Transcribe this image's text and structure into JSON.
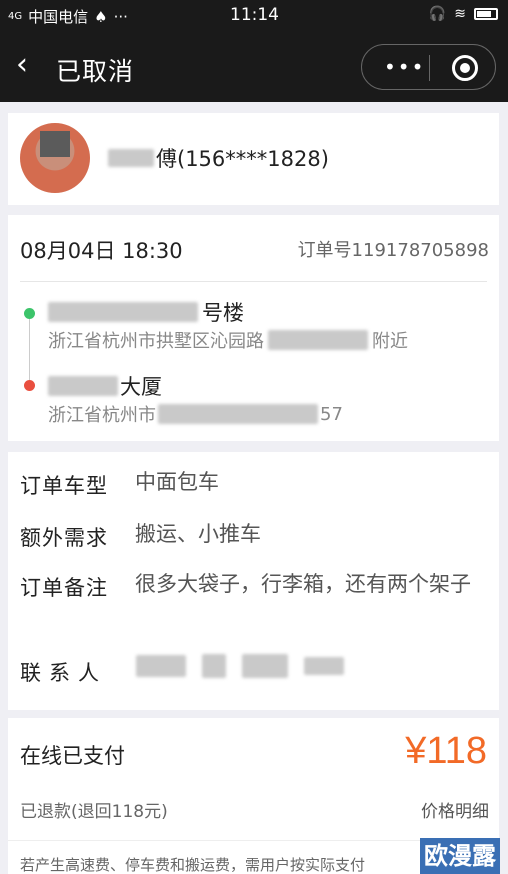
{
  "statusbar": {
    "signal": "4G",
    "carrier": "中国电信",
    "time": "11:14"
  },
  "navbar": {
    "back_icon": "chevron-left-icon",
    "title": "已取消",
    "more_label": "•••"
  },
  "driver": {
    "name_suffix": "傅(156****1828)"
  },
  "order": {
    "datetime": "08月04日 18:30",
    "order_no": "订单号119178705898",
    "from": {
      "name_suffix": "号楼",
      "address_prefix": "浙江省杭州市拱墅区沁园路",
      "address_suffix": "附近"
    },
    "to": {
      "name_suffix": "大厦",
      "address_prefix": "浙江省杭州市",
      "address_suffix": "57"
    }
  },
  "details": {
    "vehicle_label": "订单车型",
    "vehicle_value": "中面包车",
    "extra_label": "额外需求",
    "extra_value": "搬运、小推车",
    "remark_label": "订单备注",
    "remark_value": "很多大袋子，行李箱，还有两个架子",
    "contact_label": "联系人"
  },
  "payment": {
    "status": "在线已支付",
    "amount": "¥118",
    "refund": "已退款(退回118元)",
    "price_detail": "价格明细",
    "note": "若产生高速费、停车费和搬运费，需用户按实际支付"
  },
  "watermark": "欧漫露"
}
